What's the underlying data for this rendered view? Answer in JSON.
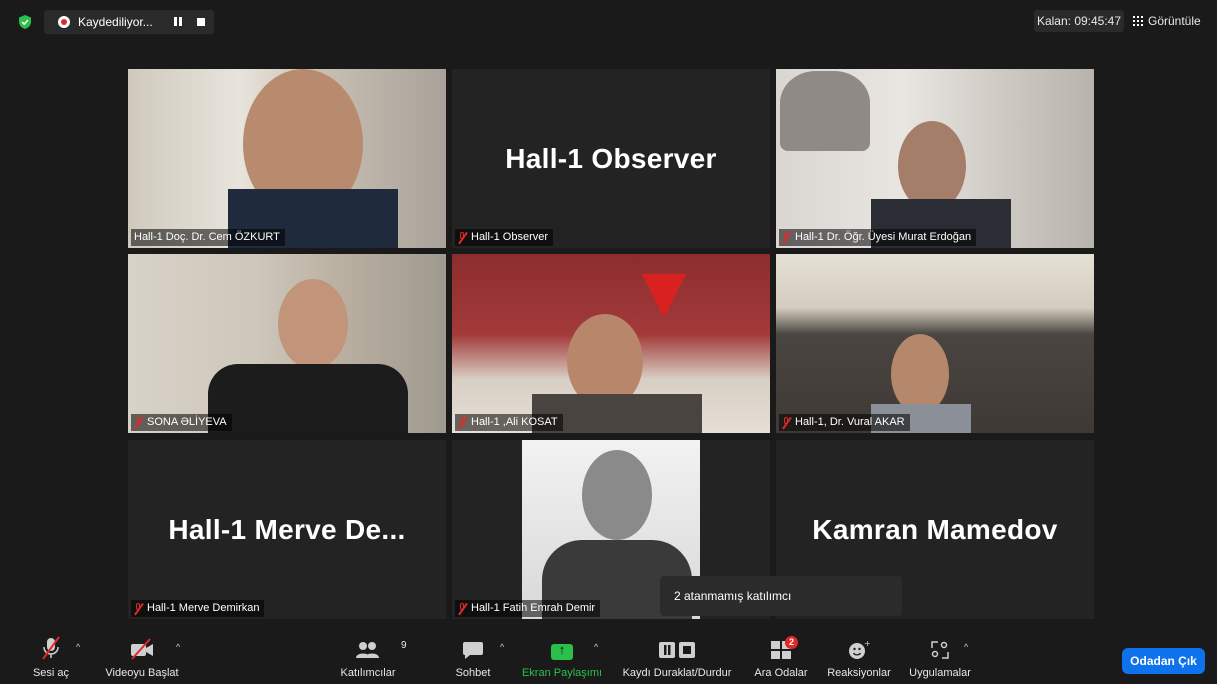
{
  "topbar": {
    "recording_label": "Kaydediliyor...",
    "timer_label": "Kalan: 09:45:47",
    "view_label": "Görüntüle"
  },
  "tiles": [
    {
      "name": "Hall-1 Doç. Dr. Cem ÖZKURT",
      "big_name": "",
      "active": true,
      "muted": false
    },
    {
      "name": "Hall-1 Observer",
      "big_name": "Hall-1 Observer",
      "muted": true
    },
    {
      "name": "Hall-1 Dr. Öğr. Üyesi Murat Erdoğan",
      "big_name": "",
      "muted": true
    },
    {
      "name": "SONA ƏLİYEVA",
      "big_name": "",
      "muted": true
    },
    {
      "name": "Hall-1 ,Ali KOSAT",
      "big_name": "",
      "muted": true
    },
    {
      "name": "Hall-1, Dr. Vural AKAR",
      "big_name": "",
      "muted": true
    },
    {
      "name": "Hall-1 Merve Demirkan",
      "big_name": "Hall-1 Merve De...",
      "muted": true
    },
    {
      "name": "Hall-1 Fatih Emrah Demir",
      "big_name": "",
      "muted": true
    },
    {
      "name": "",
      "big_name": "Kamran Mamedov",
      "muted": false
    }
  ],
  "popup": {
    "text": "2 atanmamış katılımcı"
  },
  "toolbar": {
    "mute_label": "Sesi aç",
    "video_label": "Videoyu Başlat",
    "participants_label": "Katılımcılar",
    "participants_count": "9",
    "chat_label": "Sohbet",
    "share_label": "Ekran Paylaşımı",
    "record_label": "Kaydı Duraklat/Durdur",
    "breakout_label": "Ara Odalar",
    "breakout_badge": "2",
    "reactions_label": "Reaksiyonlar",
    "apps_label": "Uygulamalar",
    "leave_label": "Odadan Çık"
  },
  "colors": {
    "active_speaker": "#b9e04a",
    "share_green": "#2bc04b",
    "leave_blue": "#0e72ed",
    "mute_red": "#e02828"
  }
}
